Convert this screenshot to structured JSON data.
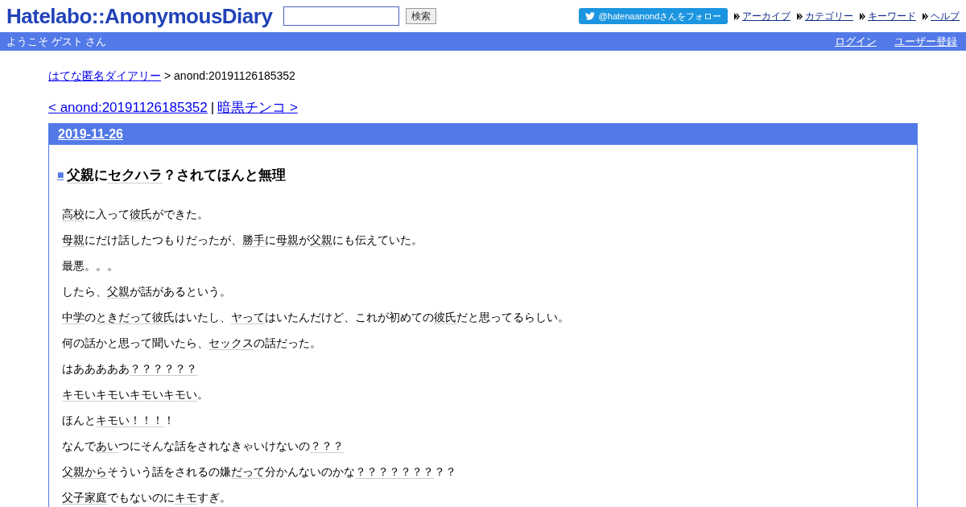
{
  "header": {
    "logo": "Hatelabo::AnonymousDiary",
    "search": {
      "button": "検索"
    },
    "follow_button": "@hatenaanondさんをフォロー",
    "nav": [
      "アーカイブ",
      "カテゴリー",
      "キーワード",
      "ヘルプ"
    ]
  },
  "user_bar": {
    "welcome": "ようこそ ゲスト さん",
    "links": [
      "ログイン",
      "ユーザー登録"
    ]
  },
  "breadcrumb": {
    "link": "はてな匿名ダイアリー",
    "current": "> anond:20191126185352"
  },
  "pager": {
    "prev": "< anond:20191126185352",
    "separator": "|",
    "next": "暗黒チンコ >"
  },
  "day": {
    "date": "2019-11-26",
    "marker": "■",
    "title": [
      {
        "text": "父親",
        "keyword": true
      },
      {
        "text": "に",
        "keyword": false
      },
      {
        "text": "セクハラ",
        "keyword": true
      },
      {
        "text": "？されてほんと無理",
        "keyword": false
      }
    ],
    "paragraphs": [
      [
        {
          "text": "高校",
          "keyword": true
        },
        {
          "text": "に入って",
          "keyword": false
        },
        {
          "text": "彼氏",
          "keyword": true
        },
        {
          "text": "ができた。",
          "keyword": false
        }
      ],
      [
        {
          "text": "母親",
          "keyword": true
        },
        {
          "text": "にだけ話したつもりだったが、",
          "keyword": false
        },
        {
          "text": "勝手",
          "keyword": true
        },
        {
          "text": "に",
          "keyword": false
        },
        {
          "text": "母親",
          "keyword": true
        },
        {
          "text": "が",
          "keyword": false
        },
        {
          "text": "父親",
          "keyword": true
        },
        {
          "text": "にも伝えていた。",
          "keyword": false
        }
      ],
      [
        {
          "text": "最悪。。。",
          "keyword": false
        }
      ],
      [
        {
          "text": "したら、",
          "keyword": false
        },
        {
          "text": "父親",
          "keyword": true
        },
        {
          "text": "が話があるという。",
          "keyword": false
        }
      ],
      [
        {
          "text": "中学",
          "keyword": true
        },
        {
          "text": "の",
          "keyword": false
        },
        {
          "text": "ときだって",
          "keyword": true
        },
        {
          "text": "彼氏",
          "keyword": true
        },
        {
          "text": "はいたし、",
          "keyword": false
        },
        {
          "text": "ヤって",
          "keyword": true
        },
        {
          "text": "はいたんだけど、これが初めての",
          "keyword": false
        },
        {
          "text": "彼氏",
          "keyword": true
        },
        {
          "text": "だと思ってるらしい。",
          "keyword": false
        }
      ],
      [
        {
          "text": "何の話かと思って聞いたら、",
          "keyword": false
        },
        {
          "text": "セックス",
          "keyword": true
        },
        {
          "text": "の話だった。",
          "keyword": false
        }
      ],
      [
        {
          "text": "はあああああ",
          "keyword": false
        },
        {
          "text": "？？？？？？",
          "keyword": true
        }
      ],
      [
        {
          "text": "キモいキモいキモいキモい",
          "keyword": true
        },
        {
          "text": "。",
          "keyword": false
        }
      ],
      [
        {
          "text": "ほんと",
          "keyword": false
        },
        {
          "text": "キモい！！！",
          "keyword": true
        },
        {
          "text": "！",
          "keyword": false
        }
      ],
      [
        {
          "text": "なんで",
          "keyword": false
        },
        {
          "text": "あい",
          "keyword": true
        },
        {
          "text": "つにそんな話をされなきゃいけないの",
          "keyword": false
        },
        {
          "text": "？？？",
          "keyword": true
        }
      ],
      [
        {
          "text": "父親から",
          "keyword": true
        },
        {
          "text": "そういう話をされるの嫌",
          "keyword": false
        },
        {
          "text": "だって",
          "keyword": true
        },
        {
          "text": "分かんないのかな",
          "keyword": false
        },
        {
          "text": "？？？？？？？",
          "keyword": true
        },
        {
          "text": "？？",
          "keyword": false
        }
      ],
      [
        {
          "text": "父子家庭",
          "keyword": true
        },
        {
          "text": "でもないのに",
          "keyword": false
        },
        {
          "text": "キモ",
          "keyword": true
        },
        {
          "text": "すぎ。",
          "keyword": false
        }
      ]
    ]
  }
}
